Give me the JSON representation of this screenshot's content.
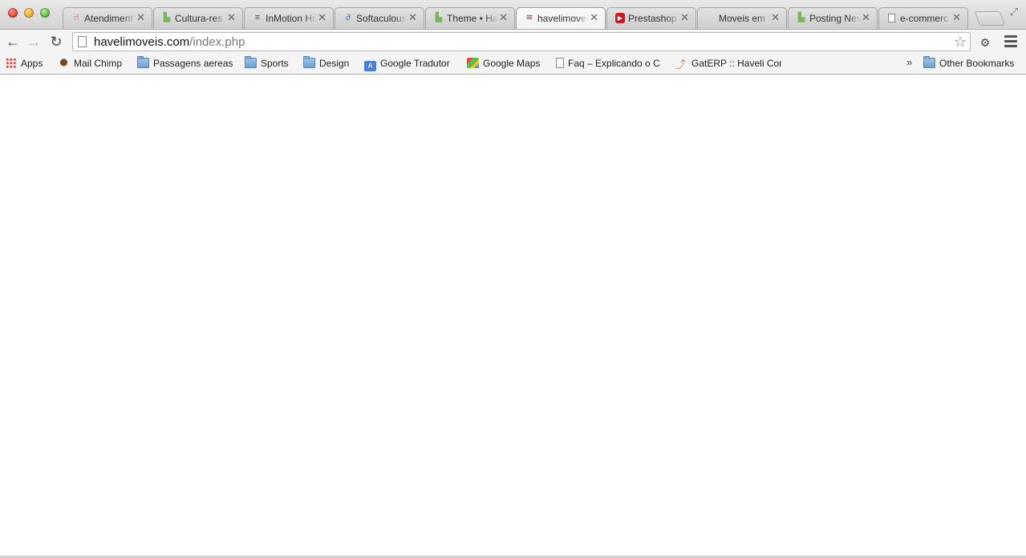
{
  "window": {
    "traffic_lights": [
      "close",
      "minimize",
      "zoom"
    ]
  },
  "tabs": [
    {
      "label": "Atendiment",
      "favicon": "chair-icon",
      "color": "#d8352b"
    },
    {
      "label": "Cultura-res",
      "favicon": "shopify-bag-icon",
      "color": "#7ab55c"
    },
    {
      "label": "InMotion Ho",
      "favicon": "inmotion-icon",
      "color": "#c8202a"
    },
    {
      "label": "Softaculous",
      "favicon": "softaculous-icon",
      "color": "#3b6fb6"
    },
    {
      "label": "Theme • Ha",
      "favicon": "shopify-bag-icon",
      "color": "#7ab55c"
    },
    {
      "label": "havelimovei",
      "favicon": "haveli-icon",
      "color": "#c8202a",
      "active": true
    },
    {
      "label": "Prestashop",
      "favicon": "youtube-icon",
      "color": "#cc181e"
    },
    {
      "label": "Moveis em I",
      "favicon": "blank-icon",
      "color": "#999999"
    },
    {
      "label": "Posting Nev",
      "favicon": "shopify-bag-icon",
      "color": "#7ab55c"
    },
    {
      "label": "e-commerc",
      "favicon": "page-icon",
      "color": "#888888"
    }
  ],
  "address_bar": {
    "domain": "havelimoveis.com",
    "path": "/index.php"
  },
  "bookmarks": [
    {
      "label": "Apps",
      "icon": "apps-grid-icon"
    },
    {
      "label": "Mail Chimp",
      "icon": "mailchimp-icon"
    },
    {
      "label": "Passagens aereas",
      "icon": "folder-icon"
    },
    {
      "label": "Sports",
      "icon": "folder-icon"
    },
    {
      "label": "Design",
      "icon": "folder-icon"
    },
    {
      "label": "Google Tradutor",
      "icon": "translate-icon"
    },
    {
      "label": "Google Maps",
      "icon": "maps-icon"
    },
    {
      "label": "Faq – Explicando o C",
      "icon": "page-icon"
    },
    {
      "label": "GatERP :: Haveli Con",
      "icon": "gaterp-icon"
    }
  ],
  "bookmarks_overflow": "»",
  "other_bookmarks": "Other Bookmarks"
}
